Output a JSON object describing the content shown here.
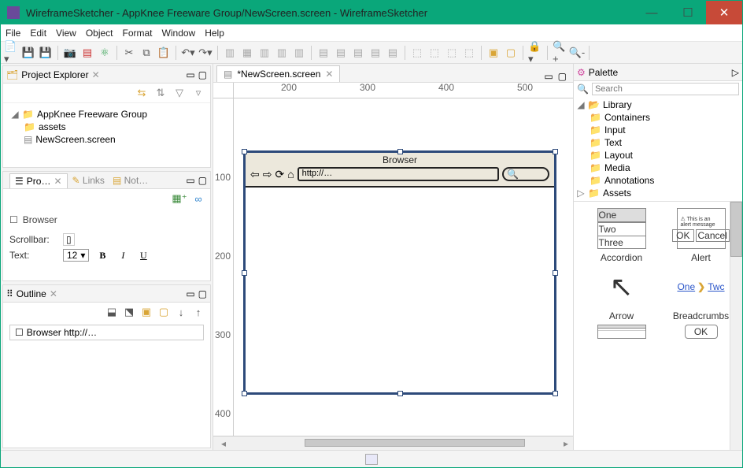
{
  "window": {
    "title": "WireframeSketcher - AppKnee Freeware Group/NewScreen.screen - WireframeSketcher",
    "min": "—",
    "max": "☐",
    "close": "✕"
  },
  "menu": [
    "File",
    "Edit",
    "View",
    "Object",
    "Format",
    "Window",
    "Help"
  ],
  "project_explorer": {
    "title": "Project Explorer",
    "tree": {
      "root": "AppKnee Freeware Group",
      "children": [
        "assets",
        "NewScreen.screen"
      ]
    }
  },
  "properties": {
    "tabs": [
      "Pro…",
      "Links",
      "Not…"
    ],
    "widget_name": "Browser",
    "rows": {
      "scrollbar_label": "Scrollbar:",
      "text_label": "Text:",
      "text_size": "12"
    },
    "format": {
      "bold": "B",
      "italic": "I",
      "underline": "U"
    }
  },
  "outline": {
    "title": "Outline",
    "item": "Browser http://…"
  },
  "editor": {
    "tab_label": "*NewScreen.screen",
    "ruler_h": [
      "200",
      "300",
      "400",
      "500"
    ],
    "ruler_v": [
      "100",
      "200",
      "300",
      "400"
    ],
    "browser_widget": {
      "title": "Browser",
      "url": "http://…",
      "icons": {
        "back": "⇦",
        "fwd": "⇨",
        "reload": "⟳",
        "home": "⌂",
        "search": "🔍"
      }
    }
  },
  "palette": {
    "title": "Palette",
    "search_placeholder": "Search",
    "tree": {
      "library": "Library",
      "cats": [
        "Containers",
        "Input",
        "Text",
        "Layout",
        "Media",
        "Annotations"
      ],
      "assets": "Assets"
    },
    "items": [
      {
        "name": "Accordion"
      },
      {
        "name": "Alert"
      },
      {
        "name": "Arrow"
      },
      {
        "name": "Breadcrumbs",
        "extra": {
          "one": "One",
          "sep": "❯",
          "two": "Twc"
        }
      }
    ]
  }
}
